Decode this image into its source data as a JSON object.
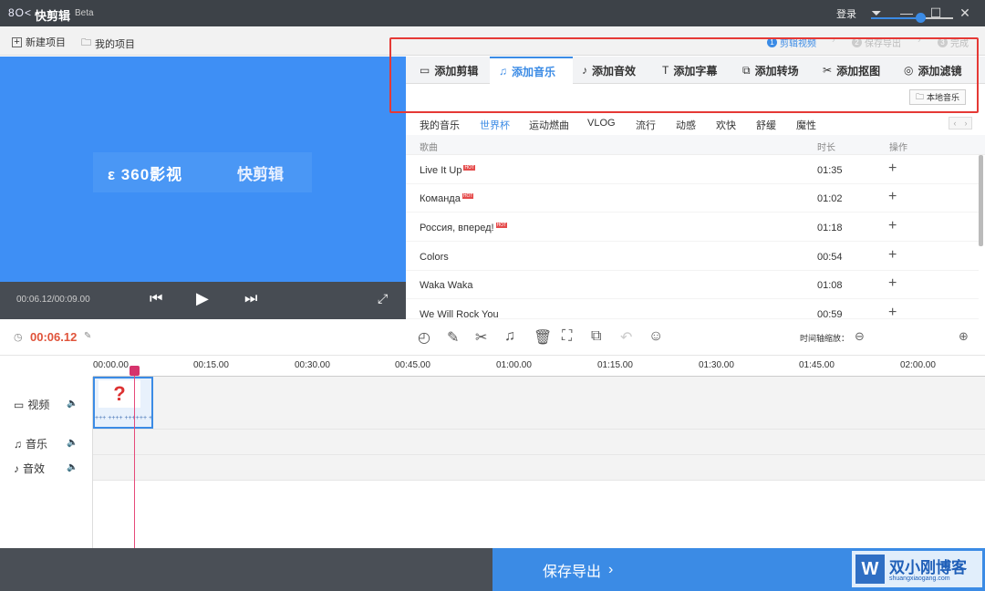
{
  "app": {
    "logo": "8O<",
    "name": "快剪辑",
    "edition": "Beta",
    "login": "登录"
  },
  "toolbar": {
    "new_project": "新建项目",
    "my_projects": "我的项目"
  },
  "steps": [
    {
      "num": "1",
      "label": "剪辑视频",
      "active": true
    },
    {
      "num": "2",
      "label": "保存导出",
      "active": false
    },
    {
      "num": "3",
      "label": "完成",
      "active": false
    }
  ],
  "preview": {
    "banner_left": "ε 360影视",
    "banner_right": "快剪辑",
    "time": "00:06.12/00:09.00"
  },
  "tabs": [
    {
      "icon": "video-icon",
      "glyph": "▭",
      "label": "添加剪辑"
    },
    {
      "icon": "music-icon",
      "glyph": "♫",
      "label": "添加音乐",
      "active": true
    },
    {
      "icon": "sound-effect-icon",
      "glyph": "♪",
      "label": "添加音效"
    },
    {
      "icon": "text-icon",
      "glyph": "T",
      "label": "添加字幕"
    },
    {
      "icon": "transition-icon",
      "glyph": "⧉",
      "label": "添加转场"
    },
    {
      "icon": "cutout-icon",
      "glyph": "✂",
      "label": "添加抠图"
    },
    {
      "icon": "filter-icon",
      "glyph": "◎",
      "label": "添加滤镜"
    }
  ],
  "local_music": "本地音乐",
  "categories": [
    "我的音乐",
    "世界杯",
    "运动燃曲",
    "VLOG",
    "流行",
    "动感",
    "欢快",
    "舒缓",
    "魔性"
  ],
  "active_category": "世界杯",
  "list_headers": {
    "song": "歌曲",
    "duration": "时长",
    "action": "操作"
  },
  "songs": [
    {
      "title": "Live It Up",
      "hot": "HOT",
      "duration": "01:35"
    },
    {
      "title": "Команда",
      "hot": "HOT",
      "duration": "01:02"
    },
    {
      "title": "Россия, вперед!",
      "hot": "HOT",
      "duration": "01:18"
    },
    {
      "title": "Colors",
      "hot": "",
      "duration": "00:54"
    },
    {
      "title": "Waka Waka",
      "hot": "",
      "duration": "01:08"
    },
    {
      "title": "We Will Rock You",
      "hot": "",
      "duration": "00:59"
    }
  ],
  "timeline": {
    "current_time": "00:06.12",
    "zoom_label": "时间轴缩放：",
    "zoom_level": 0.6,
    "ruler": [
      "00:00.00",
      "00:15.00",
      "00:30.00",
      "00:45.00",
      "01:00.00",
      "01:15.00",
      "01:30.00",
      "01:45.00",
      "02:00.00"
    ],
    "tracks": {
      "video": "视频",
      "music": "音乐",
      "sfx": "音效"
    },
    "clip_thumb": "?",
    "clip_wave": "+++ ++++ ++++++ ++++ ++++"
  },
  "save_export": "保存导出",
  "watermark": {
    "logo": "W",
    "title": "双小刚博客",
    "url": "shuangxiaogang.com"
  },
  "colors": {
    "accent": "#3b8be5",
    "highlight": "#e53935",
    "time": "#e0533a"
  }
}
